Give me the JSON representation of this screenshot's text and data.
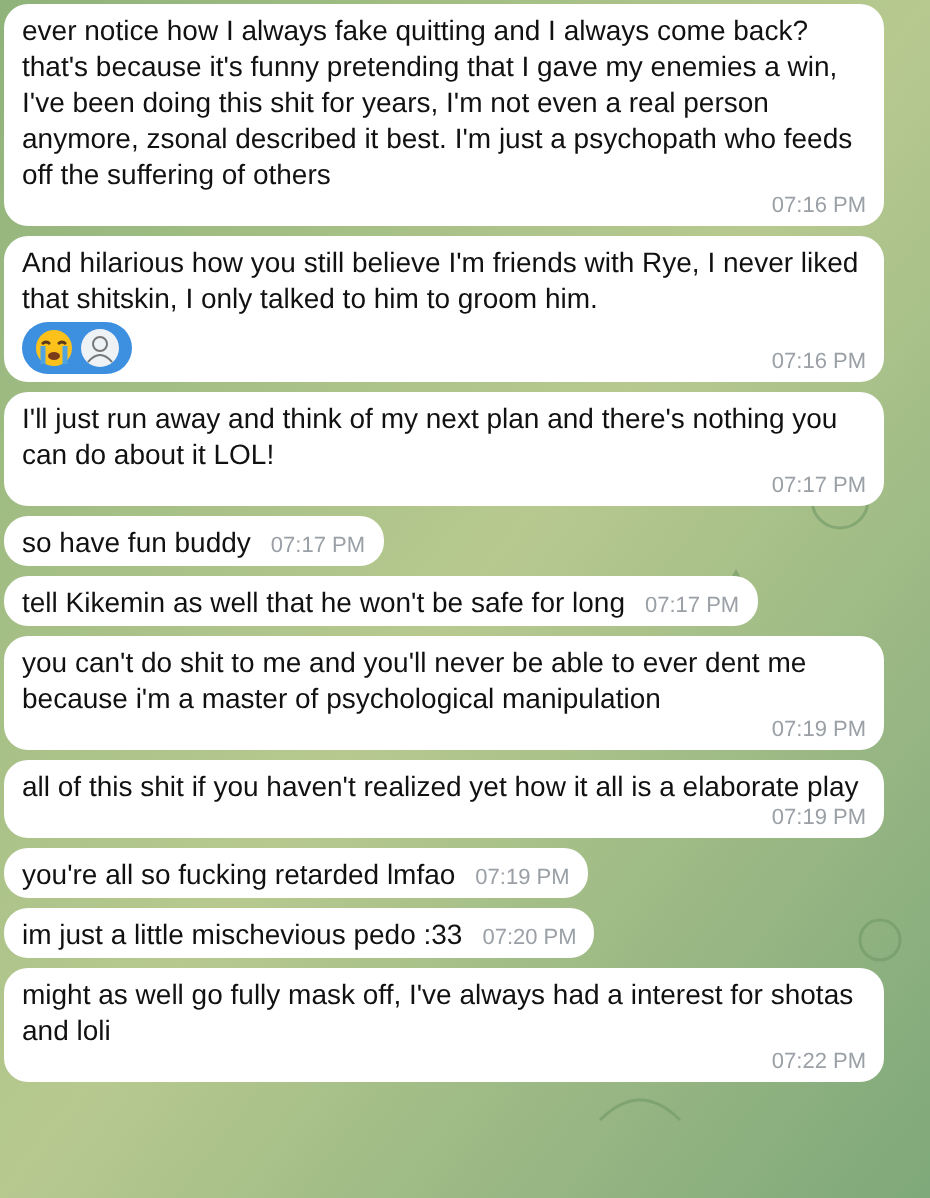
{
  "messages": [
    {
      "text": "ever notice how I always fake quitting and I always come back? that's because it's funny pretending that I gave my enemies a win, I've been doing this shit for years, I'm not even a real person anymore, zsonal described it best. I'm just a psychopath who feeds off the suffering of others",
      "time": "07:16 PM"
    },
    {
      "text": "And hilarious how you still believe I'm friends with Rye, I never liked that shitskin, I only talked to him to groom him.",
      "time": "07:16 PM",
      "reactions": [
        {
          "kind": "emoji"
        },
        {
          "kind": "avatar"
        }
      ]
    },
    {
      "text": "I'll just run away and think of my next plan and there's nothing you can do about it LOL!",
      "time": "07:17 PM"
    },
    {
      "text": "so have fun buddy",
      "time": "07:17 PM"
    },
    {
      "text": "tell Kikemin as well that he won't be safe for long",
      "time": "07:17 PM"
    },
    {
      "text": "you can't do shit to me and you'll never be able to ever dent me because i'm a master of psychological manipulation",
      "time": "07:19 PM"
    },
    {
      "text": "all of this shit if you haven't realized yet how it all is a elaborate play",
      "time": "07:19 PM"
    },
    {
      "text": "you're all so fucking retarded lmfao",
      "time": "07:19 PM"
    },
    {
      "text": "im just a little mischevious pedo :33",
      "time": "07:20 PM"
    },
    {
      "text": "might as well go fully mask off, I've always had a interest for shotas and loli",
      "time": "07:22 PM"
    }
  ]
}
